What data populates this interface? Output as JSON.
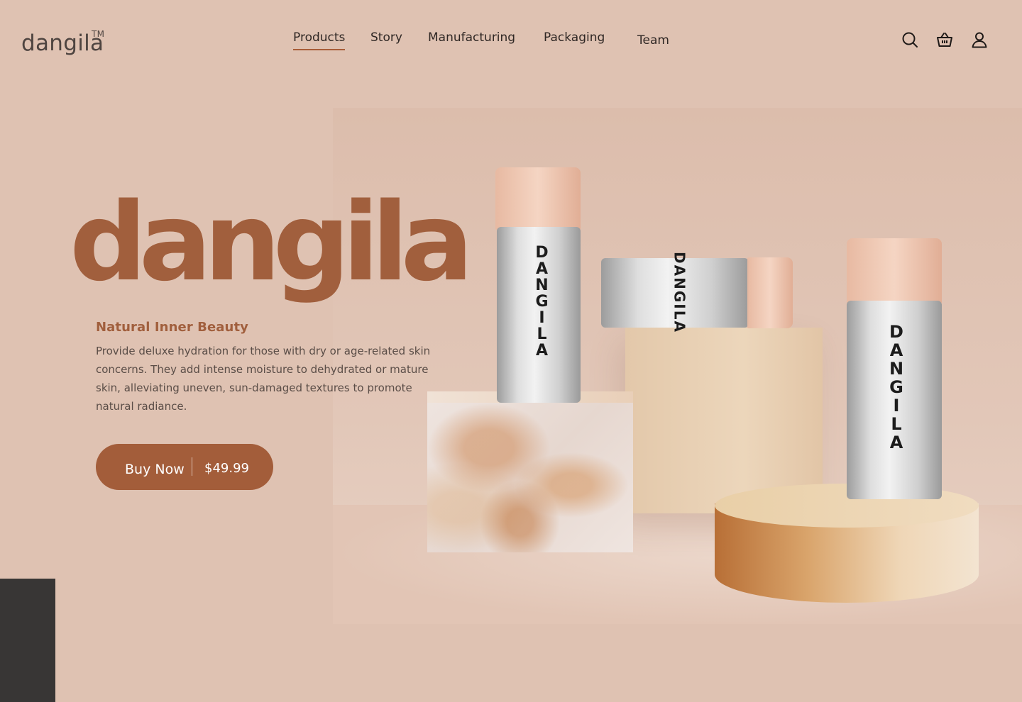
{
  "brand": {
    "name": "dangila",
    "trademark": "TM"
  },
  "nav": {
    "items": [
      {
        "label": "Products",
        "active": true
      },
      {
        "label": "Story",
        "active": false
      },
      {
        "label": "Manufacturing",
        "active": false
      },
      {
        "label": "Packaging",
        "active": false
      },
      {
        "label": "Team",
        "active": false
      }
    ]
  },
  "header_icons": [
    "search-icon",
    "basket-icon",
    "user-icon"
  ],
  "hero": {
    "word": "dangila",
    "tagline": "Natural Inner Beauty",
    "description": "Provide deluxe hydration for those with dry or age-related skin concerns. They add intense moisture to dehydrated or mature skin, alleviating uneven, sun-damaged textures to promote natural radiance.",
    "cta": {
      "label": "Buy Now",
      "price": "$49.99"
    }
  },
  "product_label": {
    "brand_vertical": "DANGILA"
  },
  "colors": {
    "background": "#dfc2b2",
    "accent": "#a15f3d",
    "button": "#a35d3a",
    "dark_block": "#383635"
  }
}
